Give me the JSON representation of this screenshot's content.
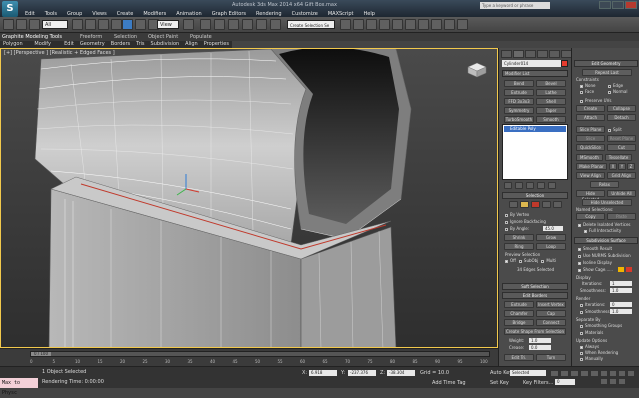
{
  "window": {
    "title": "Autodesk 3ds Max 2014 x64   Gift Box.max",
    "search_placeholder": "Type a keyword or phrase"
  },
  "menu": [
    "Edit",
    "Tools",
    "Group",
    "Views",
    "Create",
    "Modifiers",
    "Animation",
    "Graph Editors",
    "Rendering",
    "Customize",
    "MAXScript",
    "Help"
  ],
  "toolbar": {
    "selection_filter": "All",
    "ref_coord": "View",
    "named_selection": "Create Selection Se"
  },
  "ribbon_tabs": [
    "Graphite Modeling Tools",
    "Freeform",
    "Selection",
    "Object Paint",
    "Populate"
  ],
  "ribbon_sub": [
    "Polygon Modeling",
    "Modify Selection",
    "Edit",
    "Geometry (All)",
    "Borders",
    "Tris",
    "Subdivision",
    "Align",
    "Properties"
  ],
  "viewport": {
    "label": "[+] [Perspective ] [Realistic + Edged Faces ]"
  },
  "command_panel": {
    "object_name": "Cylinder014",
    "modifier_list": "Modifier List",
    "modifier_buttons": [
      [
        "Bend",
        "Bevel"
      ],
      [
        "Extrude",
        "Lathe"
      ],
      [
        "FFD 3x3x3",
        "Shell"
      ],
      [
        "Symmetry",
        "Taper"
      ],
      [
        "TurboSmooth",
        "Smooth"
      ]
    ],
    "stack_item": "Editable Poly",
    "selection": {
      "title": "Selection",
      "by_vertex": "By Vertex",
      "ignore_backfacing": "Ignore Backfacing",
      "by_angle": "By Angle:",
      "by_angle_value": "45.0",
      "shrink": "Shrink",
      "grow": "Grow",
      "ring": "Ring",
      "loop": "Loop",
      "preview": "Preview Selection",
      "preview_opts": [
        "Off",
        "SubObj",
        "Multi"
      ],
      "status": "34 Edges Selected"
    },
    "soft_selection": "Soft Selection",
    "edit_borders": {
      "title": "Edit Borders",
      "buttons": [
        [
          "Extrude",
          "Insert Vertex"
        ],
        [
          "Chamfer",
          "Cap"
        ],
        [
          "Bridge",
          "Connect"
        ]
      ],
      "create_shape": "Create Shape From Selection",
      "weight_label": "Weight:",
      "weight_value": "1.0",
      "crease_label": "Crease:",
      "crease_value": "0.0",
      "edit_tri": "Edit Tri.",
      "turn": "Turn"
    }
  },
  "right_panel": {
    "edit_geometry": "Edit Geometry",
    "repeat_last": "Repeat Last",
    "constraints": "Constraints",
    "constraint_opts": [
      [
        "None",
        "Edge"
      ],
      [
        "Face",
        "Normal"
      ]
    ],
    "preserve_uvs": "Preserve UVs",
    "create": "Create",
    "collapse": "Collapse",
    "attach": "Attach",
    "detach": "Detach",
    "slice_plane": "Slice Plane",
    "split": "Split",
    "slice": "Slice",
    "reset_plane": "Reset Plane",
    "quickslice": "QuickSlice",
    "cut": "Cut",
    "msmooth": "MSmooth",
    "tessellate": "Tessellate",
    "make_planar": "Make Planar",
    "xyz": [
      "X",
      "Y",
      "Z"
    ],
    "view_align": "View Align",
    "grid_align": "Grid Align",
    "relax": "Relax",
    "hide_selected": "Hide Selected",
    "unhide_all": "Unhide All",
    "hide_unselected": "Hide Unselected",
    "named_selections": "Named Selections:",
    "copy": "Copy",
    "paste": "Paste",
    "delete_isolated": "Delete Isolated Vertices",
    "full_interactivity": "Full Interactivity",
    "subdivision_surface": "Subdivision Surface",
    "smooth_result": "Smooth Result",
    "use_nurms": "Use NURMS Subdivision",
    "isoline": "Isoline Display",
    "show_cage": "Show Cage......",
    "display": "Display",
    "iterations_label": "Iterations:",
    "iterations_value": "1",
    "smoothness_label": "Smoothness:",
    "smoothness_value": "1.0",
    "render": "Render",
    "r_iterations_value": "0",
    "r_smoothness_value": "1.0",
    "separate_by": "Separate By",
    "smoothing_groups": "Smoothing Groups",
    "materials": "Materials",
    "update_options": "Update Options",
    "always": "Always",
    "when_rendering": "When Rendering",
    "manually": "Manually"
  },
  "timeline": {
    "frame": "0 / 100",
    "ticks": [
      "0",
      "5",
      "10",
      "15",
      "20",
      "25",
      "30",
      "35",
      "40",
      "45",
      "50",
      "55",
      "60",
      "65",
      "70",
      "75",
      "80",
      "85",
      "90",
      "95",
      "100"
    ]
  },
  "status": {
    "maxscript": "Max to Physc",
    "selected": "1 Object Selected",
    "rendering_time": "Rendering Time: 0:00:00",
    "x_label": "X:",
    "x_value": "6.918",
    "y_label": "Y:",
    "y_value": "-237.376",
    "z_label": "Z:",
    "z_value": "-38.304",
    "grid": "Grid = 10.0",
    "auto_key": "Auto Key",
    "auto_key_value": "Selected",
    "set_key": "Set Key",
    "key_filters": "Key Filters...",
    "add_time_tag": "Add Time Tag",
    "frame_value": "0"
  }
}
